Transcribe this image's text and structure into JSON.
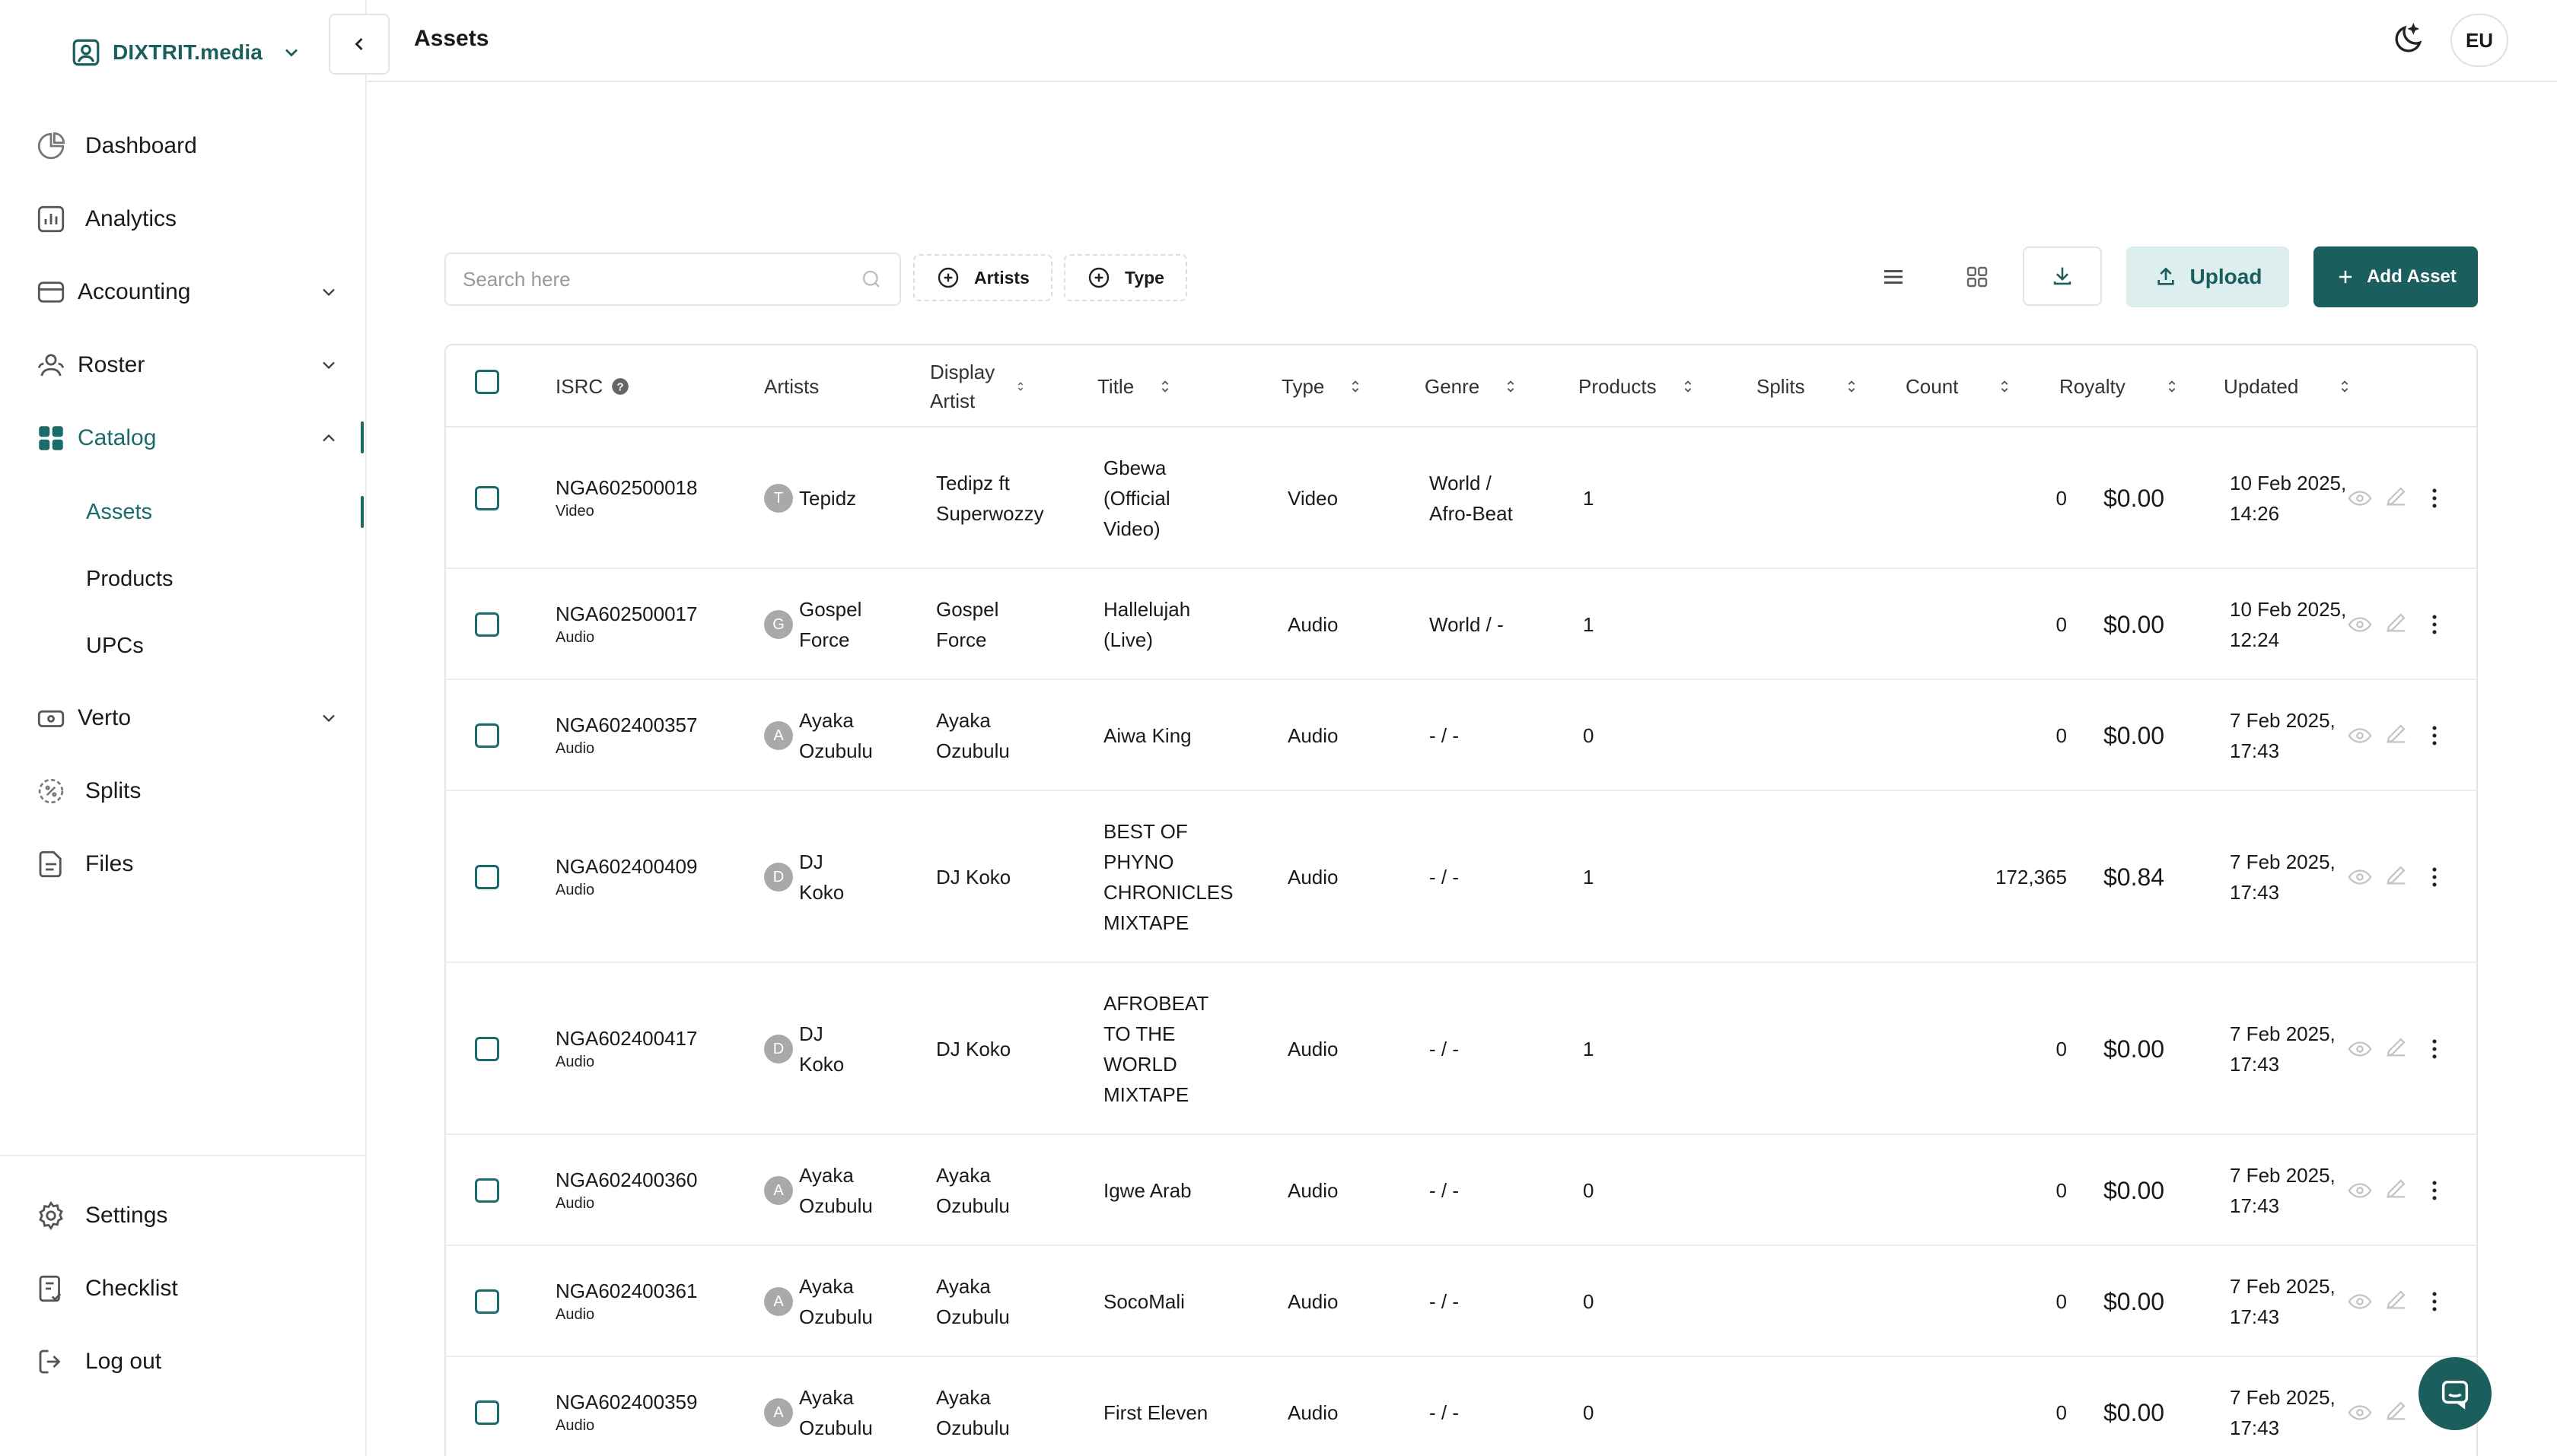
{
  "brand": {
    "name": "DIXTRIT.media"
  },
  "sidebar": {
    "items": [
      {
        "label": "Dashboard"
      },
      {
        "label": "Analytics"
      },
      {
        "label": "Accounting"
      },
      {
        "label": "Roster"
      },
      {
        "label": "Catalog"
      },
      {
        "label": "Verto"
      },
      {
        "label": "Splits"
      },
      {
        "label": "Files"
      }
    ],
    "catalog_sub": [
      {
        "label": "Assets"
      },
      {
        "label": "Products"
      },
      {
        "label": "UPCs"
      }
    ],
    "bottom": [
      {
        "label": "Settings"
      },
      {
        "label": "Checklist"
      },
      {
        "label": "Log out"
      }
    ]
  },
  "header": {
    "title": "Assets",
    "avatar_initials": "EU"
  },
  "toolbar": {
    "search_placeholder": "Search here",
    "filters": [
      {
        "label": "Artists"
      },
      {
        "label": "Type"
      }
    ],
    "upload_label": "Upload",
    "add_label": "Add Asset"
  },
  "table": {
    "columns": {
      "isrc": "ISRC",
      "artists": "Artists",
      "display_artist_1": "Display",
      "display_artist_2": "Artist",
      "title": "Title",
      "type": "Type",
      "genre": "Genre",
      "products": "Products",
      "splits": "Splits",
      "count": "Count",
      "royalty": "Royalty",
      "updated": "Updated"
    },
    "rows": [
      {
        "isrc": "NGA602500018",
        "kind": "Video",
        "initial": "T",
        "artist": [
          "Tepidz"
        ],
        "display": [
          "Tedipz ft",
          "Superwozzy"
        ],
        "title": [
          "Gbewa",
          "(Official",
          "Video)"
        ],
        "type": "Video",
        "genre": [
          "World /",
          "Afro-Beat"
        ],
        "products": "1",
        "splits": "",
        "count": "0",
        "royalty": "$0.00",
        "updated": [
          "10 Feb 2025,",
          "14:26"
        ]
      },
      {
        "isrc": "NGA602500017",
        "kind": "Audio",
        "initial": "G",
        "artist": [
          "Gospel",
          "Force"
        ],
        "display": [
          "Gospel",
          "Force"
        ],
        "title": [
          "Hallelujah",
          "(Live)"
        ],
        "type": "Audio",
        "genre": [
          "World / -"
        ],
        "products": "1",
        "splits": "",
        "count": "0",
        "royalty": "$0.00",
        "updated": [
          "10 Feb 2025,",
          "12:24"
        ]
      },
      {
        "isrc": "NGA602400357",
        "kind": "Audio",
        "initial": "A",
        "artist": [
          "Ayaka",
          "Ozubulu"
        ],
        "display": [
          "Ayaka",
          "Ozubulu"
        ],
        "title": [
          "Aiwa King"
        ],
        "type": "Audio",
        "genre": [
          "- / -"
        ],
        "products": "0",
        "splits": "",
        "count": "0",
        "royalty": "$0.00",
        "updated": [
          "7 Feb 2025,",
          "17:43"
        ]
      },
      {
        "isrc": "NGA602400409",
        "kind": "Audio",
        "initial": "D",
        "artist": [
          "DJ",
          "Koko"
        ],
        "display": [
          "DJ Koko"
        ],
        "title": [
          "BEST OF",
          "PHYNO",
          "CHRONICLES",
          "MIXTAPE"
        ],
        "type": "Audio",
        "genre": [
          "- / -"
        ],
        "products": "1",
        "splits": "",
        "count": "172,365",
        "royalty": "$0.84",
        "updated": [
          "7 Feb 2025,",
          "17:43"
        ]
      },
      {
        "isrc": "NGA602400417",
        "kind": "Audio",
        "initial": "D",
        "artist": [
          "DJ",
          "Koko"
        ],
        "display": [
          "DJ Koko"
        ],
        "title": [
          "AFROBEAT",
          "TO THE",
          "WORLD",
          "MIXTAPE"
        ],
        "type": "Audio",
        "genre": [
          "- / -"
        ],
        "products": "1",
        "splits": "",
        "count": "0",
        "royalty": "$0.00",
        "updated": [
          "7 Feb 2025,",
          "17:43"
        ]
      },
      {
        "isrc": "NGA602400360",
        "kind": "Audio",
        "initial": "A",
        "artist": [
          "Ayaka",
          "Ozubulu"
        ],
        "display": [
          "Ayaka",
          "Ozubulu"
        ],
        "title": [
          "Igwe Arab"
        ],
        "type": "Audio",
        "genre": [
          "- / -"
        ],
        "products": "0",
        "splits": "",
        "count": "0",
        "royalty": "$0.00",
        "updated": [
          "7 Feb 2025,",
          "17:43"
        ]
      },
      {
        "isrc": "NGA602400361",
        "kind": "Audio",
        "initial": "A",
        "artist": [
          "Ayaka",
          "Ozubulu"
        ],
        "display": [
          "Ayaka",
          "Ozubulu"
        ],
        "title": [
          "SocoMali"
        ],
        "type": "Audio",
        "genre": [
          "- / -"
        ],
        "products": "0",
        "splits": "",
        "count": "0",
        "royalty": "$0.00",
        "updated": [
          "7 Feb 2025,",
          "17:43"
        ]
      },
      {
        "isrc": "NGA602400359",
        "kind": "Audio",
        "initial": "A",
        "artist": [
          "Ayaka",
          "Ozubulu"
        ],
        "display": [
          "Ayaka",
          "Ozubulu"
        ],
        "title": [
          "First Eleven"
        ],
        "type": "Audio",
        "genre": [
          "- / -"
        ],
        "products": "0",
        "splits": "",
        "count": "0",
        "royalty": "$0.00",
        "updated": [
          "7 Feb 2025,",
          "17:43"
        ]
      }
    ]
  },
  "colors": {
    "accent": "#1b5e5e",
    "accent_light": "#dceeee",
    "border": "#e6e6e6"
  },
  "icons": {
    "brand": "person-badge-icon",
    "row_actions": [
      "eye-icon",
      "pencil-icon",
      "more-vertical-icon"
    ],
    "chat": "chat-bubble-icon"
  }
}
